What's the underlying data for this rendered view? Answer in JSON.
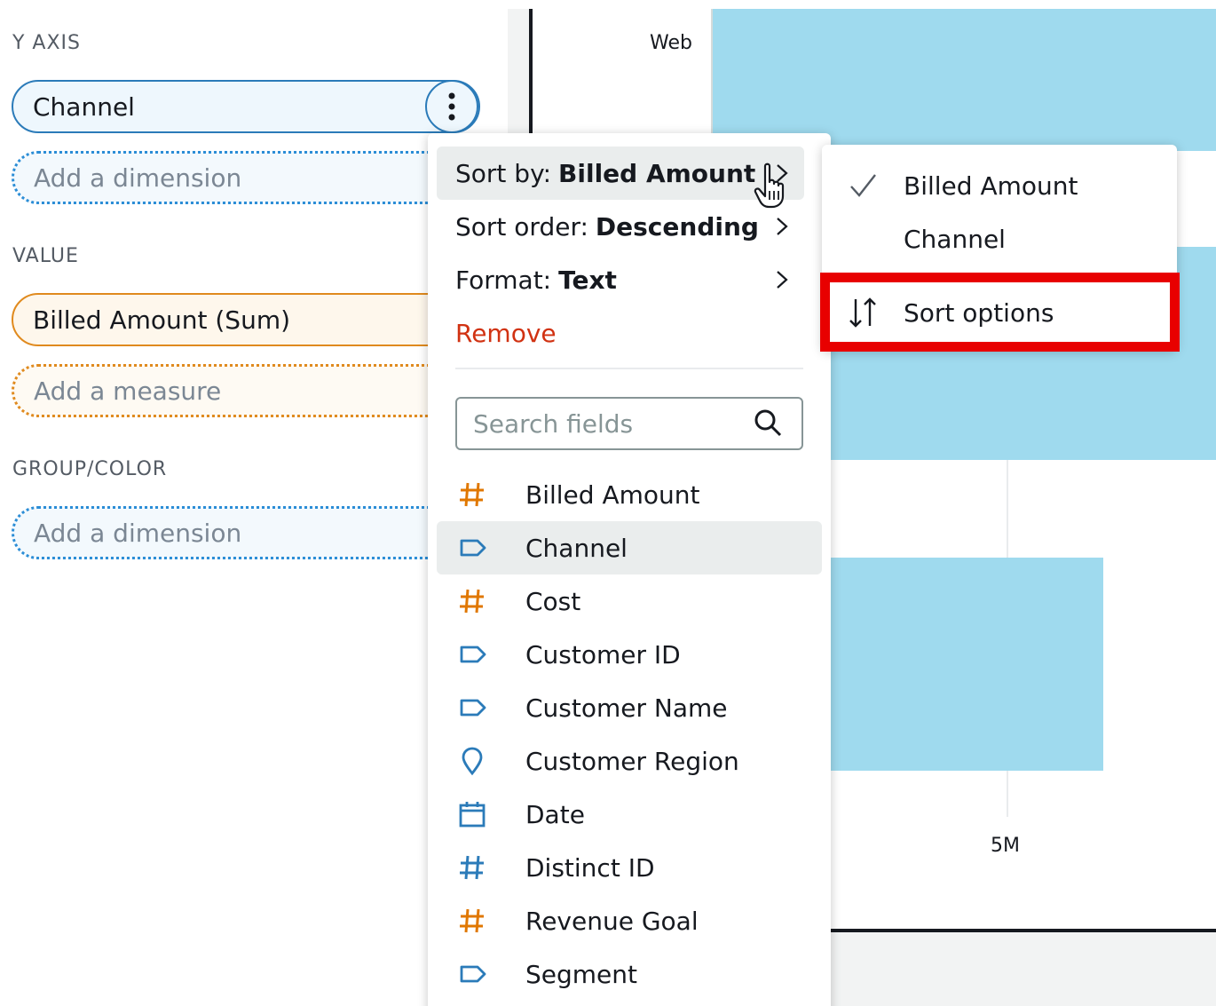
{
  "field_wells": {
    "y_axis": {
      "label": "Y AXIS",
      "field": "Channel",
      "add_placeholder": "Add a dimension"
    },
    "value": {
      "label": "VALUE",
      "field": "Billed Amount (Sum)",
      "add_placeholder": "Add a measure"
    },
    "group_color": {
      "label": "GROUP/COLOR",
      "add_placeholder": "Add a dimension"
    }
  },
  "chart": {
    "y_tick": "Web",
    "x_tick": "5M",
    "bar_color": "#9fdaee"
  },
  "context_menu": {
    "sort_by": {
      "prefix": "Sort by:",
      "value": "Billed Amount"
    },
    "sort_order": {
      "prefix": "Sort order:",
      "value": "Descending"
    },
    "format": {
      "prefix": "Format:",
      "value": "Text"
    },
    "remove": "Remove",
    "search_placeholder": "Search fields",
    "fields": [
      {
        "name": "Billed Amount",
        "icon": "hash-icon",
        "color": "#e07700"
      },
      {
        "name": "Channel",
        "icon": "tag-icon",
        "color": "#2b7bb9",
        "selected": true
      },
      {
        "name": "Cost",
        "icon": "hash-icon",
        "color": "#e07700"
      },
      {
        "name": "Customer ID",
        "icon": "tag-icon",
        "color": "#2b7bb9"
      },
      {
        "name": "Customer Name",
        "icon": "tag-icon",
        "color": "#2b7bb9"
      },
      {
        "name": "Customer Region",
        "icon": "location-pin-icon",
        "color": "#2b7bb9"
      },
      {
        "name": "Date",
        "icon": "calendar-icon",
        "color": "#2b7bb9"
      },
      {
        "name": "Distinct ID",
        "icon": "hash-icon",
        "color": "#2b7bb9"
      },
      {
        "name": "Revenue Goal",
        "icon": "hash-icon",
        "color": "#e07700"
      },
      {
        "name": "Segment",
        "icon": "tag-icon",
        "color": "#2b7bb9"
      }
    ]
  },
  "sort_submenu": {
    "items": [
      {
        "label": "Billed Amount",
        "checked": true
      },
      {
        "label": "Channel",
        "checked": false
      }
    ],
    "sort_options": "Sort options"
  },
  "colors": {
    "highlight": "#e80000",
    "remove": "#d13212"
  }
}
